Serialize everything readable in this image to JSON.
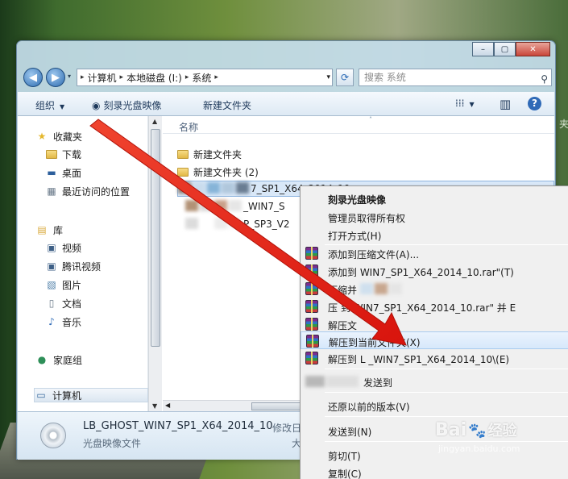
{
  "window": {
    "caption_buttons": [
      "–",
      "▢",
      "✕"
    ]
  },
  "nav": {
    "back_icon": "◀",
    "forward_icon": "▶",
    "recent_icon": "▾",
    "address": [
      "计算机",
      "本地磁盘 (I:)",
      "系统"
    ],
    "address_sep": "▸",
    "address_dropdown": "▾",
    "refresh_icon": "⟳",
    "search_placeholder": "搜索 系统",
    "search_icon": "⚲"
  },
  "toolbar": {
    "organize": "组织",
    "burn": "刻录光盘映像",
    "new_folder": "新建文件夹",
    "view_icon": "⁞⁞⁞",
    "pane_icon": "▥",
    "help_icon": "?"
  },
  "sidebar": {
    "favorites_header": "收藏夹",
    "favorites": [
      "下载",
      "桌面",
      "最近访问的位置"
    ],
    "libraries_header": "库",
    "libraries": [
      "视频",
      "腾讯视频",
      "图片",
      "文档",
      "音乐"
    ],
    "homegroup": "家庭组",
    "computer": "计算机"
  },
  "files": {
    "column_name": "名称",
    "sort_icon": "˄",
    "rows": [
      {
        "name": "新建文件夹",
        "type": "folder"
      },
      {
        "name": "新建文件夹 (2)",
        "type": "folder"
      },
      {
        "name": "7_SP1_X64_2014_10",
        "type": "selected"
      },
      {
        "name": "_WIN7_S",
        "type": "partial"
      },
      {
        "name": "P_SP3_V2",
        "type": "partial"
      }
    ]
  },
  "details": {
    "name": "LB_GHOST_WIN7_SP1_X64_2014_10",
    "type": "光盘映像文件",
    "modified_label": "修改日",
    "size_label": "大"
  },
  "context_menu": {
    "items": [
      {
        "label": "刻录光盘映像",
        "bold": true
      },
      {
        "label": "管理员取得所有权"
      },
      {
        "label": "打开方式(H)"
      },
      {
        "label": "添加到压缩文件(A)...",
        "rar": true
      },
      {
        "label": "添加到                              WIN7_SP1_X64_2014_10.rar\"(T)",
        "rar": true
      },
      {
        "label": "压缩并",
        "rar": true
      },
      {
        "label": "压            到                    WIN7_SP1_X64_2014_10.rar\" 并 E",
        "rar": true
      },
      {
        "label": "解压文",
        "rar": true
      },
      {
        "label": "解压到当前文件夹(X)",
        "rar": true,
        "hover": true
      },
      {
        "label": "解压到 L                  _WIN7_SP1_X64_2014_10\\(E)",
        "rar": true
      },
      {
        "label": "发送到"
      },
      {
        "label": "还原以前的版本(V)"
      },
      {
        "label": "发送到(N)"
      },
      {
        "label": "剪切(T)"
      },
      {
        "label": "复制(C)"
      }
    ]
  },
  "watermark": {
    "logo_left": "Bai",
    "logo_right": "经验",
    "paw": "🐾",
    "url": "jingyan.baidu.com"
  },
  "edge_text": "夹",
  "colors": {
    "arrow": "#e3251c",
    "selection": "#d9e8f8"
  }
}
